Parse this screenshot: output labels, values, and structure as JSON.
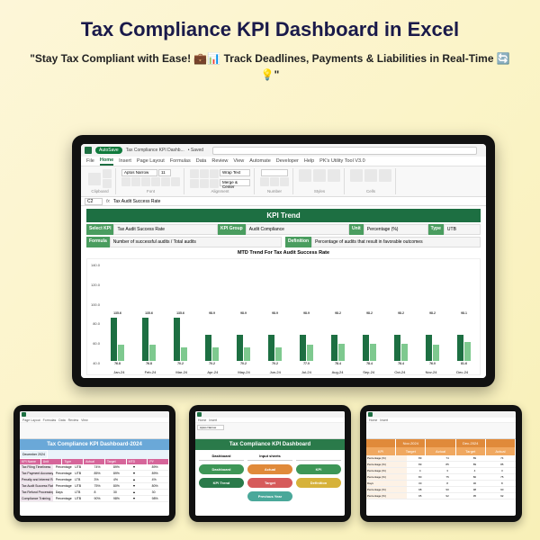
{
  "page": {
    "title": "Tax Compliance KPI Dashboard  in Excel",
    "subtitle": "\"Stay Tax Compliant with Ease! 💼📊 Track Deadlines, Payments & Liabilities in Real-Time 🔄💡\""
  },
  "excel": {
    "autosave": "AutoSave",
    "filename": "Tax Compliance KPI Dashb...",
    "saved": "Saved",
    "search_placeholder": "Search",
    "tabs": [
      "File",
      "Home",
      "Insert",
      "Page Layout",
      "Formulas",
      "Data",
      "Review",
      "View",
      "Automate",
      "Developer",
      "Help",
      "PK's Utility Tool V3.0"
    ],
    "active_tab": "Home",
    "groups": {
      "clipboard": "Clipboard",
      "font": "Font",
      "font_name": "Aptos Narrow",
      "font_size": "11",
      "alignment": "Alignment",
      "number": "Number",
      "styles": "Styles",
      "cells": "Cells"
    },
    "toolbar": {
      "paste": "Paste",
      "wrap": "Wrap Text",
      "merge": "Merge & Center",
      "cond": "Conditional Formatting",
      "table": "Format as Table",
      "cellst": "Cell Styles",
      "insert": "Insert",
      "delete": "Delete",
      "format": "Format",
      "fill": "Fill"
    },
    "cell_ref": "C2",
    "fx": "fx",
    "formula_value": "Tax Audit Success Rate"
  },
  "kpi": {
    "banner": "KPI Trend",
    "select_kpi_lbl": "Select KPI",
    "select_kpi_val": "Tax Audit Success Rate",
    "group_lbl": "KPI Group",
    "group_val": "Audit Compliance",
    "unit_lbl": "Unit",
    "unit_val": "Percentage (%)",
    "type_lbl": "Type",
    "type_val": "UTB",
    "formula_lbl": "Formula",
    "formula_val": "Number of successful audits / Total audits",
    "definition_lbl": "Definition",
    "definition_val": "Percentage of audits that result in favorable outcomes",
    "chart_title": "MTD Trend For Tax Audit Success Rate"
  },
  "chart_data": {
    "type": "bar",
    "categories": [
      "Jan-24",
      "Feb-24",
      "Mar-24",
      "Apr-24",
      "May-24",
      "Jun-24",
      "Jul-24",
      "Aug-24",
      "Sep-24",
      "Oct-24",
      "Nov-24",
      "Dec-24"
    ],
    "series": [
      {
        "name": "Target",
        "values": [
          135.6,
          135.6,
          135.6,
          98.9,
          98.9,
          98.9,
          98.9,
          98.2,
          98.2,
          98.2,
          98.2,
          98.1
        ]
      },
      {
        "name": "Actual",
        "values": [
          76.8,
          76.8,
          70.2,
          70.2,
          70.2,
          70.2,
          77.0,
          78.4,
          78.4,
          78.4,
          76.0,
          81.6
        ]
      }
    ],
    "yticks": [
      "140.0",
      "120.0",
      "100.0",
      "80.0",
      "60.0",
      "40.0"
    ],
    "ylim": [
      40,
      140
    ]
  },
  "tablet_left": {
    "title": "Tax Compliance KPI Dashboard-2024",
    "month_lbl": "December 2024",
    "headers": [
      "KPI Name",
      "Unit",
      "Type",
      "Actual",
      "Target",
      "MTD",
      "PY"
    ],
    "rows": [
      [
        "Tax Filing Timeliness",
        "Percentage (%)",
        "UTB",
        "74%",
        "89%",
        "▼",
        "89%"
      ],
      [
        "Tax Payment Accuracy",
        "Percentage (%)",
        "UTB",
        "85%",
        "89%",
        "▼",
        "89%"
      ],
      [
        "Penalty and Interest Rate",
        "Percentage (%)",
        "LTB",
        "3%",
        "4%",
        "▲",
        "4%"
      ],
      [
        "Tax Audit Success Rate",
        "Percentage (%)",
        "UTB",
        "75%",
        "80%",
        "▼",
        "80%"
      ],
      [
        "Tax Refund Processing",
        "Days",
        "LTB",
        "8",
        "30",
        "▲",
        "30"
      ],
      [
        "Compliance Training",
        "Percentage (%)",
        "UTB",
        "90%",
        "98%",
        "▼",
        "98%"
      ]
    ]
  },
  "tablet_mid": {
    "title": "Tax Compliance KPI Dashboard",
    "left_hdr": "Dashboard",
    "right_hdr": "Input sheets",
    "left_buttons": [
      "Dashboard",
      "KPI Trend"
    ],
    "right_buttons": [
      "Actual",
      "Target",
      "Previous Year",
      "KPI",
      "Definition"
    ]
  },
  "tablet_right": {
    "month_headers": [
      "",
      "Nov-2024",
      "",
      "Dec-2024",
      ""
    ],
    "sub_headers": [
      "KPI",
      "Target",
      "Actual",
      "Target",
      "Actual"
    ],
    "rows": [
      [
        "Percentage (%)",
        "89",
        "74",
        "89",
        "74"
      ],
      [
        "Percentage (%)",
        "89",
        "85",
        "89",
        "85"
      ],
      [
        "Percentage (%)",
        "4",
        "3",
        "4",
        "3"
      ],
      [
        "Percentage (%)",
        "80",
        "75",
        "80",
        "75"
      ],
      [
        "Days",
        "30",
        "8",
        "30",
        "8"
      ],
      [
        "Percentage (%)",
        "98",
        "90",
        "98",
        "90"
      ],
      [
        "Percentage (%)",
        "95",
        "92",
        "95",
        "92"
      ]
    ]
  }
}
